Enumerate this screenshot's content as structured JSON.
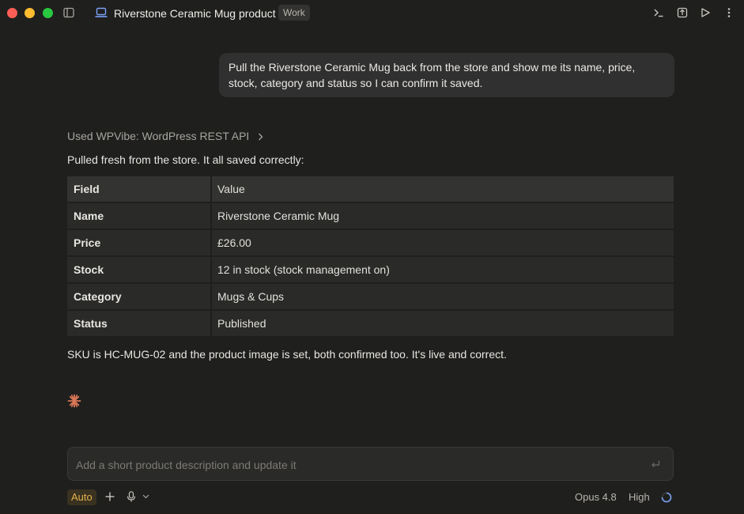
{
  "window": {
    "title": "Riverstone Ceramic Mug product",
    "tag": "Work"
  },
  "conversation": {
    "user_message": "Pull the Riverstone Ceramic Mug back from the store and show me its name, price, stock, category and status so I can confirm it saved.",
    "tool_used": "Used WPVibe: WordPress REST API",
    "intro": "Pulled fresh from the store. It all saved correctly:",
    "table": {
      "headers": [
        "Field",
        "Value"
      ],
      "rows": [
        [
          "Name",
          "Riverstone Ceramic Mug"
        ],
        [
          "Price",
          "£26.00"
        ],
        [
          "Stock",
          "12 in stock (stock management on)"
        ],
        [
          "Category",
          "Mugs & Cups"
        ],
        [
          "Status",
          "Published"
        ]
      ]
    },
    "outro": "SKU is HC-MUG-02 and the product image is set, both confirmed too. It's live and correct."
  },
  "composer": {
    "placeholder": "Add a short product description and update it",
    "mode": "Auto",
    "model": "Opus 4.8",
    "effort": "High"
  },
  "colors": {
    "accent_star": "#d97757",
    "auto_badge": "#e2b14c"
  }
}
